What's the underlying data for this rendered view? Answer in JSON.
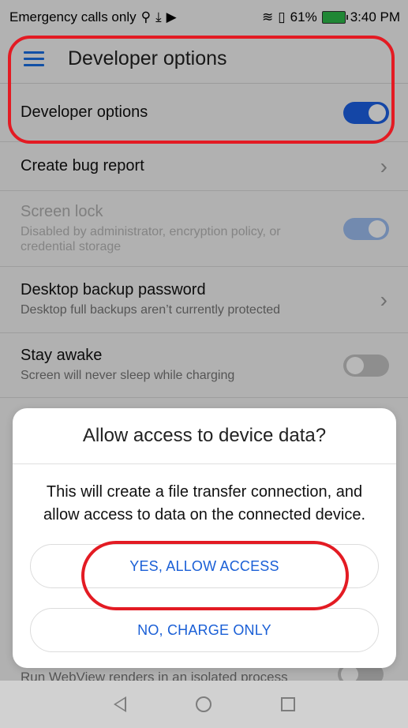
{
  "status_bar": {
    "carrier": "Emergency calls only",
    "battery_percent": "61%",
    "time": "3:40 PM"
  },
  "app_bar": {
    "title": "Developer options"
  },
  "settings": [
    {
      "title": "Developer options",
      "subtitle": "",
      "control": "switch-on"
    },
    {
      "title": "Create bug report",
      "subtitle": "",
      "control": "chevron"
    },
    {
      "title": "Screen lock",
      "subtitle": "Disabled by administrator, encryption policy, or credential storage",
      "control": "switch-disabled-on"
    },
    {
      "title": "Desktop backup password",
      "subtitle": "Desktop full backups aren’t currently protected",
      "control": "chevron"
    },
    {
      "title": "Stay awake",
      "subtitle": "Screen will never sleep while charging",
      "control": "switch-off"
    }
  ],
  "peek_text": "Run WebView renders in an isolated process",
  "dialog": {
    "title": "Allow access to device data?",
    "message": "This will create a file transfer connection, and allow access to data on the connected device.",
    "yes_label": "YES, ALLOW ACCESS",
    "no_label": "NO, CHARGE ONLY"
  },
  "colors": {
    "accent": "#1d62e6",
    "highlight": "#e31b23"
  },
  "icons": {
    "menu": "hamburger-icon",
    "back": "back-icon",
    "home": "home-icon",
    "recent": "recent-apps-icon"
  }
}
